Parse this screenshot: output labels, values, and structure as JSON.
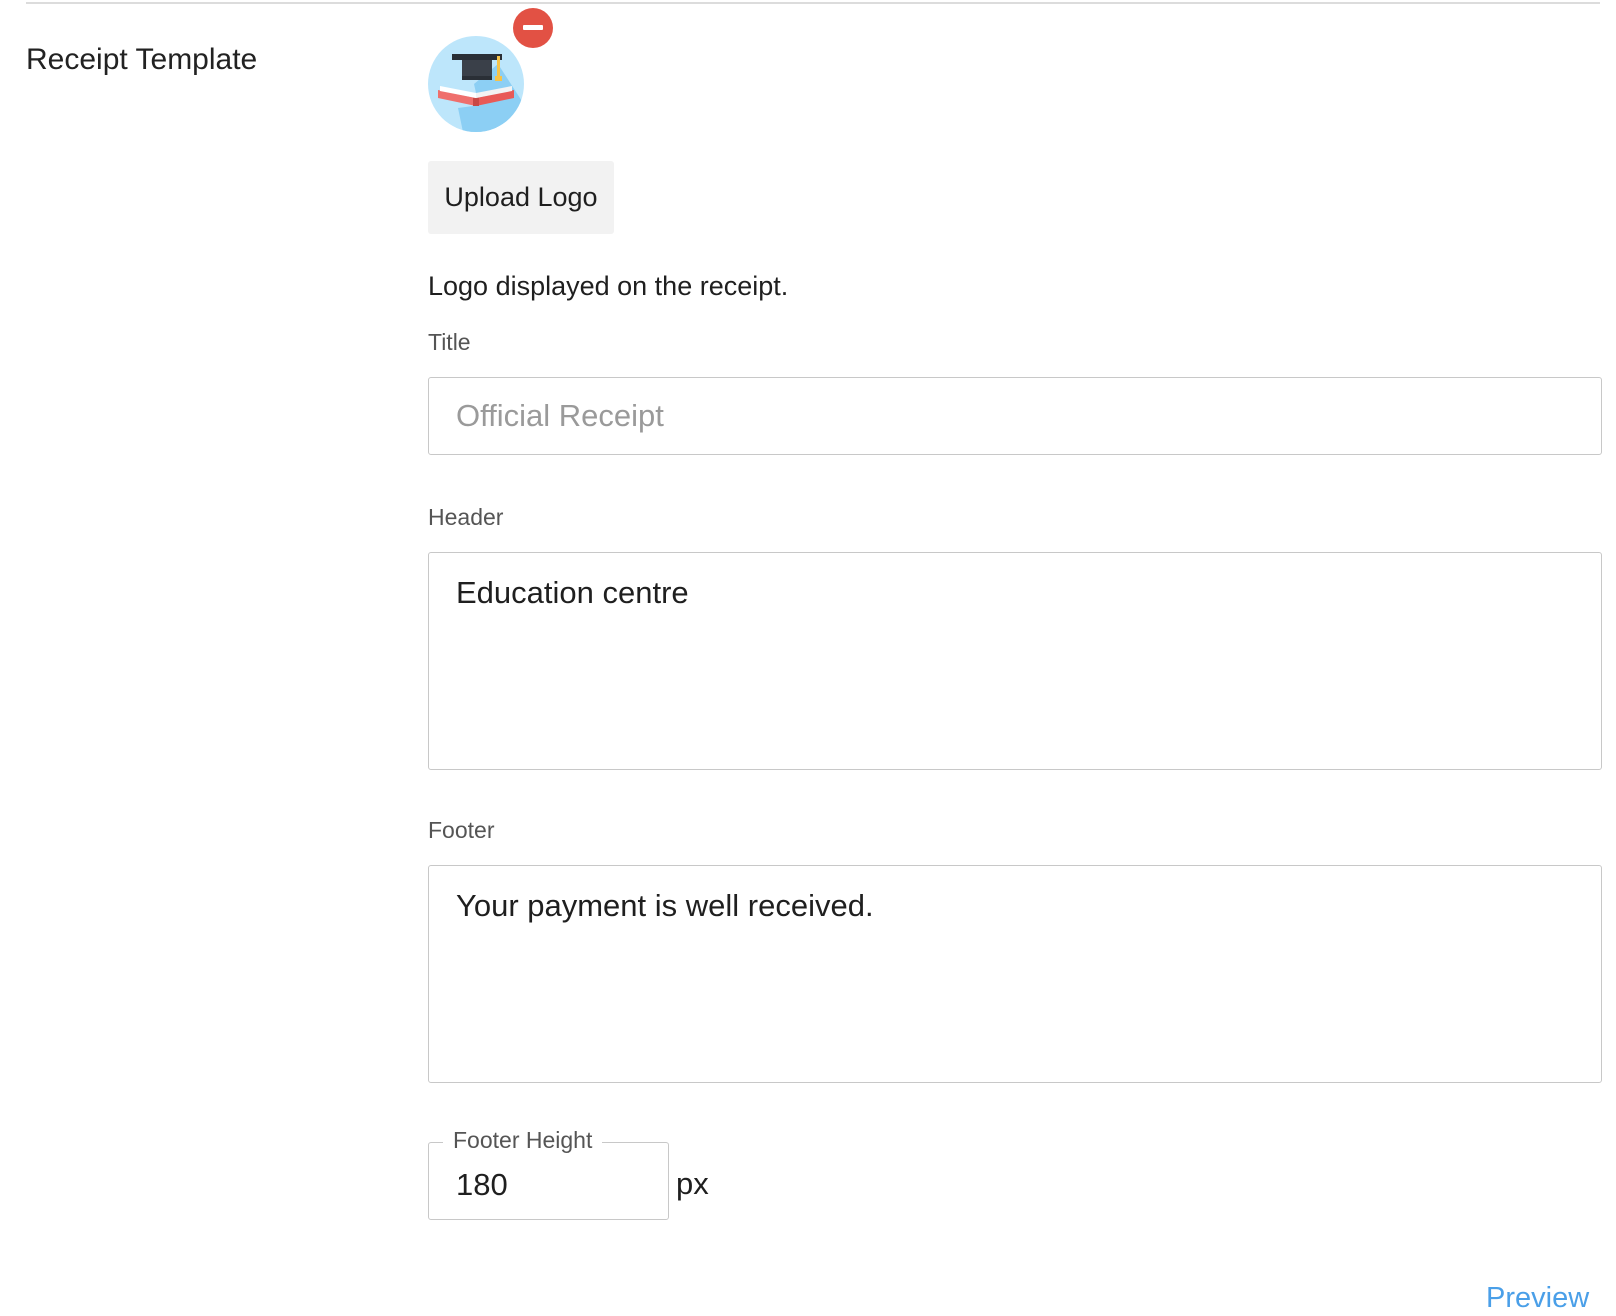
{
  "section": {
    "title": "Receipt Template"
  },
  "logo": {
    "icon": "graduation-cap-book-icon",
    "remove_icon": "minus-circle-icon",
    "upload_label": "Upload Logo",
    "helper_text": "Logo displayed on the receipt."
  },
  "fields": {
    "title": {
      "label": "Title",
      "placeholder": "Official Receipt",
      "value": ""
    },
    "header": {
      "label": "Header",
      "value": "Education centre"
    },
    "footer": {
      "label": "Footer",
      "value": "Your payment is well received."
    },
    "footer_height": {
      "label": "Footer Height",
      "value": "180",
      "unit": "px"
    }
  },
  "actions": {
    "preview_label": "Preview"
  },
  "colors": {
    "accent": "#4a9fe8",
    "danger": "#e25144",
    "border": "#c8c8c8"
  }
}
